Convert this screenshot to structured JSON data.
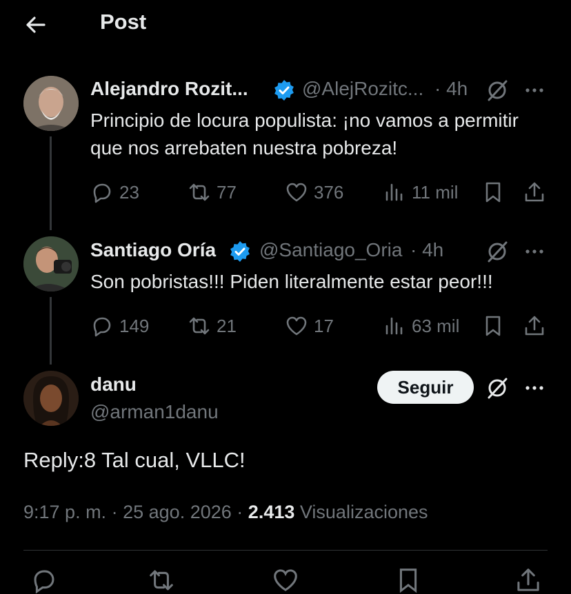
{
  "header": {
    "title": "Post"
  },
  "tweets": [
    {
      "name": "Alejandro Rozit...",
      "handle": "@AlejRozitc...",
      "time": "· 4h",
      "text": "Principio de locura populista: ¡no vamos a permitir que nos arrebaten nuestra pobreza!",
      "replies": "23",
      "reposts": "77",
      "likes": "376",
      "views": "11 mil"
    },
    {
      "name": "Santiago Oría",
      "handle": "@Santiago_Oria",
      "time": "· 4h",
      "text": "Son pobristas!!! Piden literalmente estar peor!!!",
      "replies": "149",
      "reposts": "21",
      "likes": "17",
      "views": "63 mil"
    }
  ],
  "main_post": {
    "name": "danu",
    "handle": "@arman1danu",
    "follow_label": "Seguir",
    "text": "Reply:8 Tal cual, VLLC!",
    "time": "9:17 p. m.",
    "separator1": "·",
    "date": "25 ago. 2026",
    "separator2": "·",
    "views_count": "2.413",
    "views_label": "Visualizaciones"
  },
  "colors": {
    "verified": "#1d9bf0",
    "muted": "#71767b",
    "text": "#e7e9ea",
    "background": "#000000"
  },
  "icons": [
    "back-arrow-icon",
    "verified-badge-icon",
    "grok-icon",
    "more-icon",
    "reply-icon",
    "repost-icon",
    "like-icon",
    "views-icon",
    "bookmark-icon",
    "share-icon"
  ]
}
